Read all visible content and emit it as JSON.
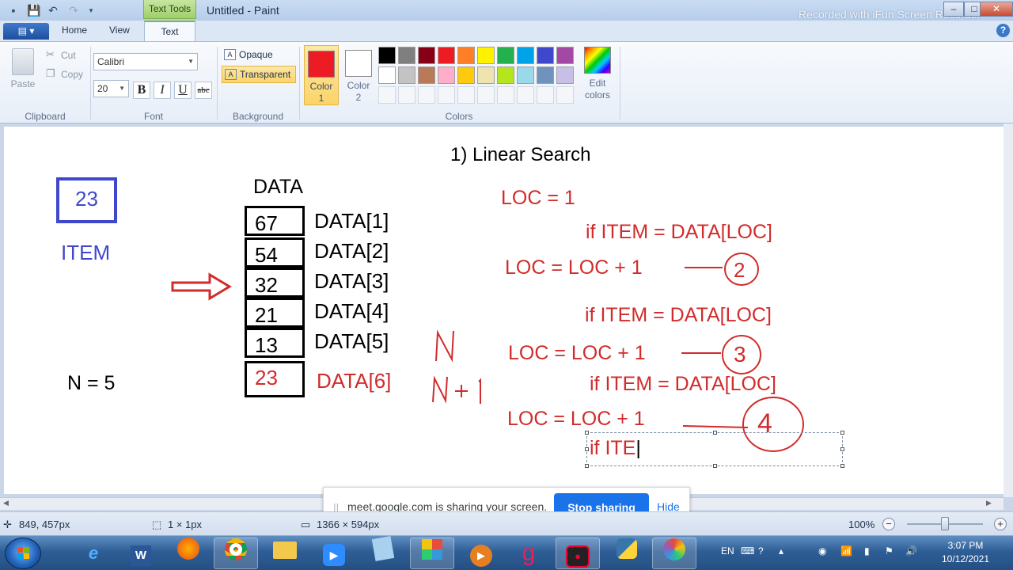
{
  "window": {
    "context_tab": "Text Tools",
    "title": "Untitled - Paint",
    "watermark": "Recorded with iFun Screen Recorder"
  },
  "tabs": {
    "home": "Home",
    "view": "View",
    "text": "Text"
  },
  "ribbon": {
    "clipboard": {
      "paste": "Paste",
      "cut": "Cut",
      "copy": "Copy",
      "label": "Clipboard"
    },
    "font": {
      "family": "Calibri",
      "size": "20",
      "bold": "B",
      "italic": "I",
      "underline": "U",
      "strike": "abc",
      "label": "Font"
    },
    "background": {
      "opaque": "Opaque",
      "transparent": "Transparent",
      "label": "Background"
    },
    "colors": {
      "color1": "Color 1",
      "color2": "Color 2",
      "color1_value": "#ed1c24",
      "color2_value": "#ffffff",
      "edit": "Edit colors",
      "label": "Colors",
      "palette": [
        "#000000",
        "#7f7f7f",
        "#880015",
        "#ed1c24",
        "#ff7f27",
        "#fff200",
        "#22b14c",
        "#00a2e8",
        "#3f48cc",
        "#a349a4",
        "#ffffff",
        "#c3c3c3",
        "#b97a57",
        "#ffaec9",
        "#ffc90e",
        "#efe4b0",
        "#b5e61d",
        "#99d9ea",
        "#7092be",
        "#c8bfe7"
      ]
    }
  },
  "canvas": {
    "heading": "1) Linear Search",
    "item_value": "23",
    "item_label": "ITEM",
    "n_label": "N  = 5",
    "data_label": "DATA",
    "cells": [
      "67",
      "54",
      "32",
      "21",
      "13",
      "23"
    ],
    "indices": [
      "DATA[1]",
      "DATA[2]",
      "DATA[3]",
      "DATA[4]",
      "DATA[5]",
      "DATA[6]"
    ],
    "hand_n": "N",
    "hand_n1": "N+1",
    "lines": {
      "loc_init": "LOC = 1",
      "if1": "if ITEM =  DATA[LOC]",
      "inc1": "LOC = LOC + 1",
      "if2": "if ITEM = DATA[LOC]",
      "inc2": "LOC = LOC + 1",
      "if3": "if  ITEM =  DATA[LOC]",
      "inc3": "LOC = LOC + 1",
      "typing": "if ITE"
    },
    "circles": [
      "2",
      "3",
      "4"
    ]
  },
  "sharebar": {
    "message": "meet.google.com is sharing your screen.",
    "stop": "Stop sharing",
    "hide": "Hide"
  },
  "status": {
    "cursor": "849, 457px",
    "selection": "1 × 1px",
    "canvas_size": "1366 × 594px",
    "zoom": "100%"
  },
  "taskbar": {
    "lang": "EN",
    "time": "3:07 PM",
    "date": "10/12/2021"
  }
}
